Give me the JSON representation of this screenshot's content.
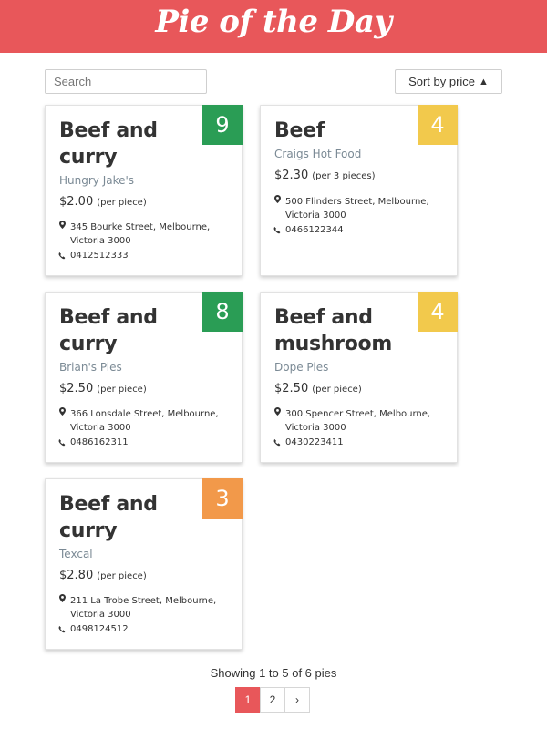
{
  "header": {
    "title": "Pie of the Day"
  },
  "search": {
    "placeholder": "Search",
    "value": ""
  },
  "sort": {
    "label": "Sort by price",
    "arrow": "▲"
  },
  "colors": {
    "brand": "#e8575a",
    "rating_high": "#2a9d55",
    "rating_mid": "#f2c94c",
    "rating_low": "#f2994a"
  },
  "pies": [
    {
      "name": "Beef and curry",
      "shop": "Hungry Jake's",
      "price": "$2.00",
      "unit": "(per piece)",
      "address": "345 Bourke Street, Melbourne, Victoria 3000",
      "phone": "0412512333",
      "rating": "9",
      "rating_color": "#2a9d55"
    },
    {
      "name": "Beef",
      "shop": "Craigs Hot Food",
      "price": "$2.30",
      "unit": "(per 3 pieces)",
      "address": "500 Flinders Street, Melbourne, Victoria 3000",
      "phone": "0466122344",
      "rating": "4",
      "rating_color": "#f2c94c"
    },
    {
      "name": "Beef and curry",
      "shop": "Brian's Pies",
      "price": "$2.50",
      "unit": "(per piece)",
      "address": "366 Lonsdale Street, Melbourne, Victoria 3000",
      "phone": "0486162311",
      "rating": "8",
      "rating_color": "#2a9d55"
    },
    {
      "name": "Beef and mushroom",
      "shop": "Dope Pies",
      "price": "$2.50",
      "unit": "(per piece)",
      "address": "300 Spencer Street, Melbourne, Victoria 3000",
      "phone": "0430223411",
      "rating": "4",
      "rating_color": "#f2c94c"
    },
    {
      "name": "Beef and curry",
      "shop": "Texcal",
      "price": "$2.80",
      "unit": "(per piece)",
      "address": "211 La Trobe Street, Melbourne, Victoria 3000",
      "phone": "0498124512",
      "rating": "3",
      "rating_color": "#f2994a"
    }
  ],
  "footer": {
    "showing": "Showing 1 to 5 of 6 pies"
  },
  "pagination": {
    "pages": [
      "1",
      "2"
    ],
    "active": "1",
    "next": "›"
  }
}
